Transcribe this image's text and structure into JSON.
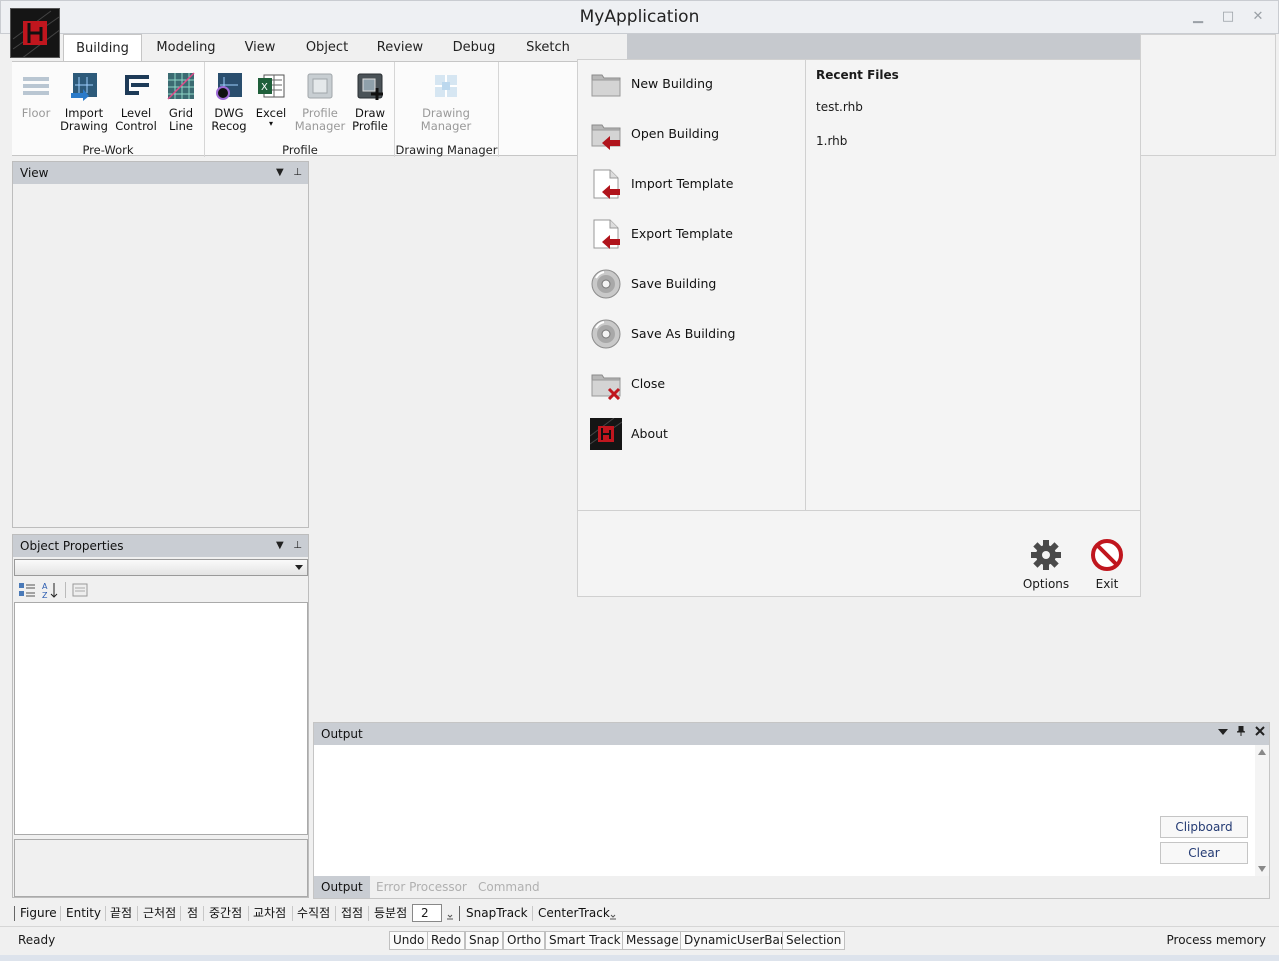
{
  "window": {
    "title": "MyApplication",
    "minimize": "▁",
    "maximize": "□",
    "close": "✕"
  },
  "ribbon_tabs": [
    "Building",
    "Modeling",
    "View",
    "Object",
    "Review",
    "Debug",
    "Sketch"
  ],
  "ribbon": {
    "buttons": [
      {
        "label1": "Floor",
        "label2": "",
        "icon": "floor-icon"
      },
      {
        "label1": "Import",
        "label2": "Drawing",
        "icon": "import-drawing-icon"
      },
      {
        "label1": "Level",
        "label2": "Control",
        "icon": "level-control-icon"
      },
      {
        "label1": "Grid",
        "label2": "Line",
        "icon": "grid-line-icon"
      },
      {
        "label1": "DWG",
        "label2": "Recog",
        "icon": "dwg-recog-icon"
      },
      {
        "label1": "Excel",
        "label2": "▾",
        "icon": "excel-icon"
      },
      {
        "label1": "Profile",
        "label2": "Manager",
        "icon": "profile-manager-icon"
      },
      {
        "label1": "Draw",
        "label2": "Profile",
        "icon": "draw-profile-icon"
      },
      {
        "label1": "Drawing",
        "label2": "Manager",
        "icon": "drawing-manager-icon"
      }
    ],
    "groups": [
      "Pre-Work",
      "Profile",
      "Drawing Manager"
    ]
  },
  "view_panel": {
    "title": "View",
    "dropdown": "▼",
    "pin": "⊥"
  },
  "properties_panel": {
    "title": "Object Properties",
    "dropdown": "▼",
    "pin": "⊥",
    "select_value": ""
  },
  "backstage": {
    "items": [
      {
        "label": "New Building",
        "icon": "folder-icon"
      },
      {
        "label": "Open Building",
        "icon": "open-folder-icon"
      },
      {
        "label": "Import Template",
        "icon": "import-template-icon"
      },
      {
        "label": "Export Template",
        "icon": "export-template-icon"
      },
      {
        "label": "Save Building",
        "icon": "disc-icon"
      },
      {
        "label": "Save As Building",
        "icon": "disc-icon"
      },
      {
        "label": "Close",
        "icon": "close-folder-icon"
      },
      {
        "label": "About",
        "icon": "app-logo-icon"
      }
    ],
    "recent_title": "Recent Files",
    "recent_files": [
      "test.rhb",
      "1.rhb"
    ],
    "options_label": "Options",
    "exit_label": "Exit"
  },
  "output_panel": {
    "title": "Output",
    "clipboard_label": "Clipboard",
    "clear_label": "Clear",
    "tabs": [
      "Output",
      "Error Processor",
      "Command"
    ]
  },
  "snap_toolbar": {
    "items": [
      "Figure",
      "Entity",
      "끝점",
      "근처점",
      "점",
      "중간점",
      "교차점",
      "수직점",
      "접점",
      "등분점"
    ],
    "count": "2",
    "track_items": [
      "SnapTrack",
      "CenterTrack"
    ]
  },
  "status_bar": {
    "status": "Ready",
    "buttons": [
      "Undo",
      "Redo",
      "Snap",
      "Ortho",
      "Smart Track",
      "Message",
      "DynamicUserBar",
      "Selection"
    ],
    "process_memory": "Process memory"
  },
  "colors": {
    "accent_red": "#b0141c",
    "panel_header": "#c9cdd3",
    "link_blue": "#233a73"
  }
}
